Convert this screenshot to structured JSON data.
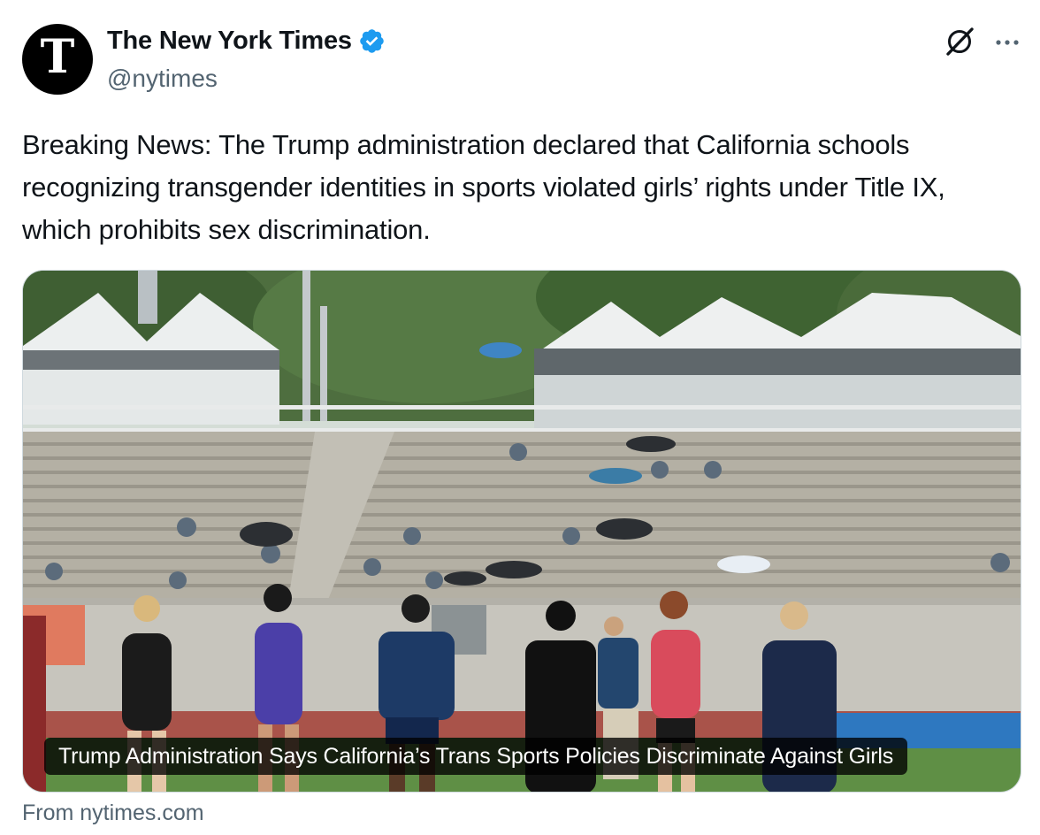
{
  "author": {
    "display_name": "The New York Times",
    "handle": "@nytimes",
    "avatar_glyph": "T",
    "verified_icon": "verified-badge-icon",
    "verified_color": "#1d9bf0"
  },
  "header_actions": {
    "grok_icon": "grok-icon",
    "more_icon": "more-icon"
  },
  "tweet": {
    "text": "Breaking News: The Trump administration declared that California schools recognizing transgender identities in sports violated girls’ rights under Title IX, which prohibits sex discrimination."
  },
  "link_card": {
    "title": "Trump Administration Says California’s Trans Sports Policies Discriminate Against Girls",
    "source": "From nytimes.com"
  },
  "colors": {
    "text_primary": "#0f1419",
    "text_secondary": "#536471",
    "border": "#cfd9de"
  }
}
